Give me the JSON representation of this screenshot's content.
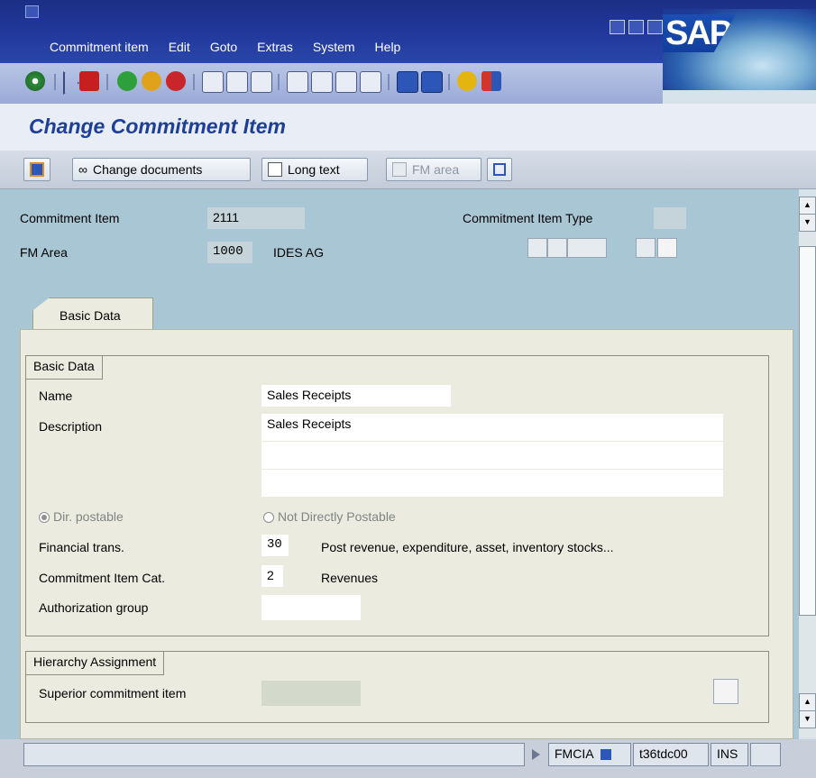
{
  "menubar": [
    "Commitment item",
    "Edit",
    "Goto",
    "Extras",
    "System",
    "Help"
  ],
  "brand": {
    "logo_text": "SAP"
  },
  "app": {
    "title": "Change Commitment Item"
  },
  "appbar": {
    "change_documents": "Change documents",
    "long_text": "Long text",
    "fm_area": "FM area"
  },
  "header": {
    "commitment_item_label": "Commitment Item",
    "commitment_item_value": "2111",
    "fm_area_label": "FM Area",
    "fm_area_value": "1000",
    "fm_area_text": "IDES AG",
    "type_label": "Commitment Item Type",
    "type_value": ""
  },
  "tabs": [
    {
      "label": "Basic Data"
    }
  ],
  "basic": {
    "group_title": "Basic Data",
    "name_label": "Name",
    "name_value": "Sales Receipts",
    "desc_label": "Description",
    "desc_value": "Sales Receipts",
    "desc_line2": "",
    "desc_line3": "",
    "dir_postable": "Dir. postable",
    "not_postable": "Not Directly Postable",
    "fin_label": "Financial trans.",
    "fin_value": "30",
    "fin_text": "Post revenue, expenditure, asset, inventory stocks...",
    "cat_label": "Commitment Item Cat.",
    "cat_value": "2",
    "cat_text": "Revenues",
    "auth_label": "Authorization group",
    "auth_value": ""
  },
  "hierarchy": {
    "group_title": "Hierarchy Assignment",
    "superior_label": "Superior commitment item",
    "superior_value": ""
  },
  "status": {
    "transaction": "FMCIA",
    "server": "t36tdc00",
    "mode": "INS"
  },
  "colors": {
    "title_blue": "#1d3f97",
    "menubar_blue": "#22399c",
    "content_bg": "#a9c6d5"
  }
}
